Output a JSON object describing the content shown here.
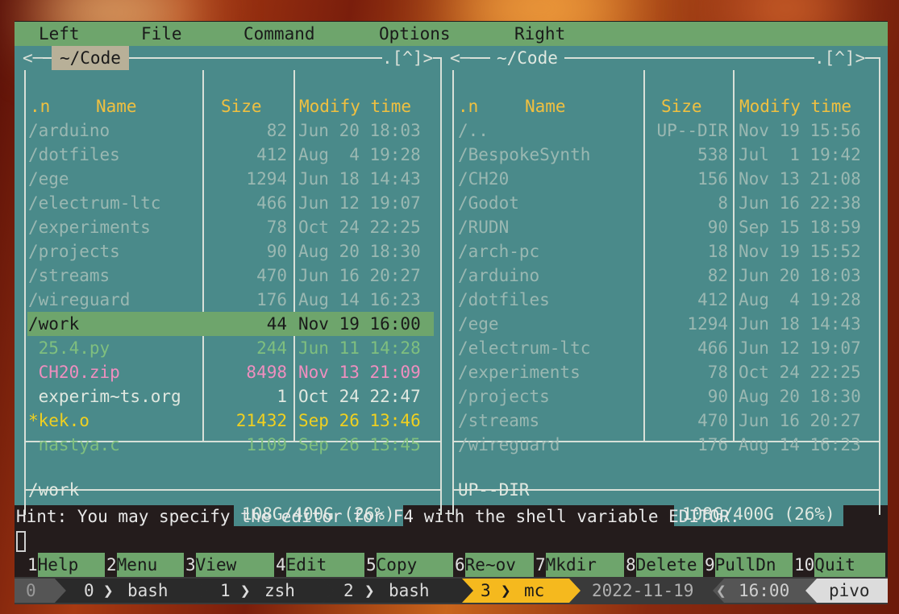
{
  "menu": [
    "Left",
    "File",
    "Command",
    "Options",
    "Right"
  ],
  "left_panel": {
    "title": "~/Code",
    "corner": ".[^]>",
    "headers": {
      "n": ".n",
      "name": "Name",
      "size": "Size",
      "mtime": "Modify time"
    },
    "rows": [
      {
        "name": "/arduino",
        "size": "82",
        "date": "Jun 20 18:03",
        "kind": "dir"
      },
      {
        "name": "/dotfiles",
        "size": "412",
        "date": "Aug  4 19:28",
        "kind": "dir"
      },
      {
        "name": "/ege",
        "size": "1294",
        "date": "Jun 18 14:43",
        "kind": "dir"
      },
      {
        "name": "/electrum-ltc",
        "size": "466",
        "date": "Jun 12 19:07",
        "kind": "dir"
      },
      {
        "name": "/experiments",
        "size": "78",
        "date": "Oct 24 22:25",
        "kind": "dir"
      },
      {
        "name": "/projects",
        "size": "90",
        "date": "Aug 20 18:30",
        "kind": "dir"
      },
      {
        "name": "/streams",
        "size": "470",
        "date": "Jun 16 20:27",
        "kind": "dir"
      },
      {
        "name": "/wireguard",
        "size": "176",
        "date": "Aug 14 16:23",
        "kind": "dir"
      },
      {
        "name": "/work",
        "size": "44",
        "date": "Nov 19 16:00",
        "kind": "selected"
      },
      {
        "name": " 25.4.py",
        "size": "244",
        "date": "Jun 11 14:28",
        "kind": "source"
      },
      {
        "name": " CH20.zip",
        "size": "8498",
        "date": "Nov 13 21:09",
        "kind": "archive"
      },
      {
        "name": " experim~ts.org",
        "size": "1",
        "date": "Oct 24 22:47",
        "kind": "file"
      },
      {
        "name": "*kek.o",
        "size": "21432",
        "date": "Sep 26 13:46",
        "kind": "exec"
      },
      {
        "name": " nastya.c",
        "size": "1109",
        "date": "Sep 26 13:45",
        "kind": "source"
      }
    ],
    "footer": "/work",
    "free": "108G/400G (26%)"
  },
  "right_panel": {
    "title": "~/Code",
    "left_corner": "<─",
    "corner": ".[^]>",
    "headers": {
      "n": ".n",
      "name": "Name",
      "size": "Size",
      "mtime": "Modify time"
    },
    "rows": [
      {
        "name": "/..",
        "size": "UP--DIR",
        "date": "Nov 19 15:56",
        "kind": "dir"
      },
      {
        "name": "/BespokeSynth",
        "size": "538",
        "date": "Jul  1 19:42",
        "kind": "dir"
      },
      {
        "name": "/CH20",
        "size": "156",
        "date": "Nov 13 21:08",
        "kind": "dir"
      },
      {
        "name": "/Godot",
        "size": "8",
        "date": "Jun 16 22:38",
        "kind": "dir"
      },
      {
        "name": "/RUDN",
        "size": "90",
        "date": "Sep 15 18:59",
        "kind": "dir"
      },
      {
        "name": "/arch-pc",
        "size": "18",
        "date": "Nov 19 15:52",
        "kind": "dir"
      },
      {
        "name": "/arduino",
        "size": "82",
        "date": "Jun 20 18:03",
        "kind": "dir"
      },
      {
        "name": "/dotfiles",
        "size": "412",
        "date": "Aug  4 19:28",
        "kind": "dir"
      },
      {
        "name": "/ege",
        "size": "1294",
        "date": "Jun 18 14:43",
        "kind": "dir"
      },
      {
        "name": "/electrum-ltc",
        "size": "466",
        "date": "Jun 12 19:07",
        "kind": "dir"
      },
      {
        "name": "/experiments",
        "size": "78",
        "date": "Oct 24 22:25",
        "kind": "dir"
      },
      {
        "name": "/projects",
        "size": "90",
        "date": "Aug 20 18:30",
        "kind": "dir"
      },
      {
        "name": "/streams",
        "size": "470",
        "date": "Jun 16 20:27",
        "kind": "dir"
      },
      {
        "name": "/wireguard",
        "size": "176",
        "date": "Aug 14 16:23",
        "kind": "dir"
      }
    ],
    "footer": "UP--DIR",
    "free": "108G/400G (26%)"
  },
  "hint": "Hint: You may specify the editor for F4 with the shell variable EDITOR.",
  "fkeys": [
    {
      "n": "1",
      "label": "Help"
    },
    {
      "n": "2",
      "label": "Menu"
    },
    {
      "n": "3",
      "label": "View"
    },
    {
      "n": "4",
      "label": "Edit"
    },
    {
      "n": "5",
      "label": "Copy"
    },
    {
      "n": "6",
      "label": "Re~ov"
    },
    {
      "n": "7",
      "label": "Mkdir"
    },
    {
      "n": "8",
      "label": "Delete"
    },
    {
      "n": "9",
      "label": "PullDn"
    },
    {
      "n": "10",
      "label": "Quit"
    }
  ],
  "tmux": {
    "session": "0",
    "windows": [
      {
        "index": "0",
        "name": "bash",
        "active": false
      },
      {
        "index": "1",
        "name": "zsh",
        "active": false
      },
      {
        "index": "2",
        "name": "bash",
        "active": false
      },
      {
        "index": "3",
        "name": "mc",
        "active": true
      }
    ],
    "date": "2022-11-19",
    "time": "16:00",
    "host": "pivo"
  },
  "colors": {
    "panel_bg": "#4a8a8a",
    "selection": "#6ea56c",
    "header": "#f0c040",
    "dir": "#9ab8b2",
    "source": "#7fbf7f",
    "archive": "#ef8fbf",
    "exec": "#f0d020",
    "file": "#e0e8e0",
    "tmux_active": "#f5b91e"
  }
}
